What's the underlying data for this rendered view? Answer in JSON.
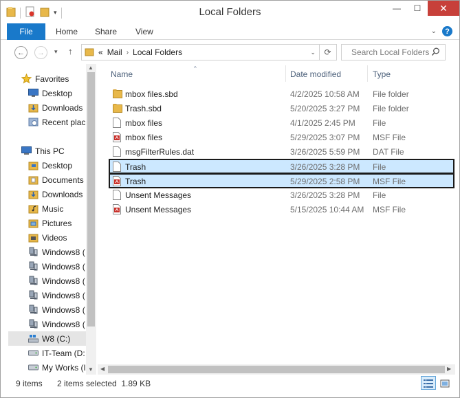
{
  "window": {
    "title": "Local Folders"
  },
  "window_controls": {
    "minimize": "—",
    "maximize": "☐",
    "close": "✕"
  },
  "ribbon": {
    "tabs": [
      {
        "label": "File"
      },
      {
        "label": "Home"
      },
      {
        "label": "Share"
      },
      {
        "label": "View"
      }
    ],
    "help": "?"
  },
  "address": {
    "prefix": "«",
    "crumbs": [
      "Mail",
      "Local Folders"
    ],
    "search_placeholder": "Search Local Folders"
  },
  "nav": {
    "favorites_label": "Favorites",
    "favorites": [
      "Desktop",
      "Downloads",
      "Recent plac"
    ],
    "thispc_label": "This PC",
    "thispc": [
      "Desktop",
      "Documents",
      "Downloads",
      "Music",
      "Pictures",
      "Videos"
    ],
    "drives": [
      "Windows8 (",
      "Windows8 (",
      "Windows8 (",
      "Windows8 (",
      "Windows8 (",
      "Windows8 ("
    ],
    "other_drives": [
      "W8 (C:)",
      "IT-Team (D:",
      "My Works (I"
    ]
  },
  "columns": {
    "name": "Name",
    "date": "Date modified",
    "type": "Type"
  },
  "files": [
    {
      "name": "mbox files.sbd",
      "date": "4/2/2025 10:58 AM",
      "type": "File folder",
      "icon": "folder-icon"
    },
    {
      "name": "Trash.sbd",
      "date": "5/20/2025 3:27 PM",
      "type": "File folder",
      "icon": "folder-icon"
    },
    {
      "name": "mbox files",
      "date": "4/1/2025 2:45 PM",
      "type": "File",
      "icon": "file-icon"
    },
    {
      "name": "mbox files",
      "date": "5/29/2025 3:07 PM",
      "type": "MSF File",
      "icon": "msf-file-icon"
    },
    {
      "name": "msgFilterRules.dat",
      "date": "3/26/2025 5:59 PM",
      "type": "DAT File",
      "icon": "file-icon"
    },
    {
      "name": "Trash",
      "date": "3/26/2025 3:28 PM",
      "type": "File",
      "icon": "file-icon",
      "selected": true
    },
    {
      "name": "Trash",
      "date": "5/29/2025 2:58 PM",
      "type": "MSF File",
      "icon": "msf-file-icon",
      "selected": true
    },
    {
      "name": "Unsent Messages",
      "date": "3/26/2025 3:28 PM",
      "type": "File",
      "icon": "file-icon"
    },
    {
      "name": "Unsent Messages",
      "date": "5/15/2025 10:44 AM",
      "type": "MSF File",
      "icon": "msf-file-icon"
    }
  ],
  "status": {
    "count": "9 items",
    "selection": "2 items selected  1.89 KB"
  },
  "colors": {
    "accent": "#1979ca",
    "selection": "#cce8ff",
    "close": "#c7403a"
  }
}
